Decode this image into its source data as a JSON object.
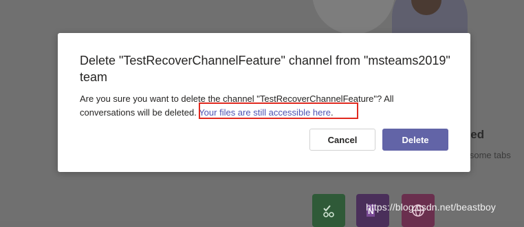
{
  "background": {
    "heading": "rted",
    "subtext": "d some tabs",
    "tiles": [
      {
        "icon": "planner-icon",
        "color": "#2f5a38"
      },
      {
        "icon": "onenote-icon",
        "color": "#4a2f5a"
      },
      {
        "icon": "globe-icon",
        "color": "#6a2f4e"
      }
    ]
  },
  "dialog": {
    "title": "Delete \"TestRecoverChannelFeature\" channel from \"msteams2019\" team",
    "body_text": "Are you sure you want to delete the channel \"TestRecoverChannelFeature\"? All conversations will be deleted. ",
    "link_text": "Your files are still accessible here",
    "link_suffix": ".",
    "cancel_label": "Cancel",
    "delete_label": "Delete"
  },
  "colors": {
    "accent": "#6264a7",
    "link": "#4f52b2",
    "highlight": "#e0281e"
  },
  "watermark": "https://blog.csdn.net/beastboy"
}
